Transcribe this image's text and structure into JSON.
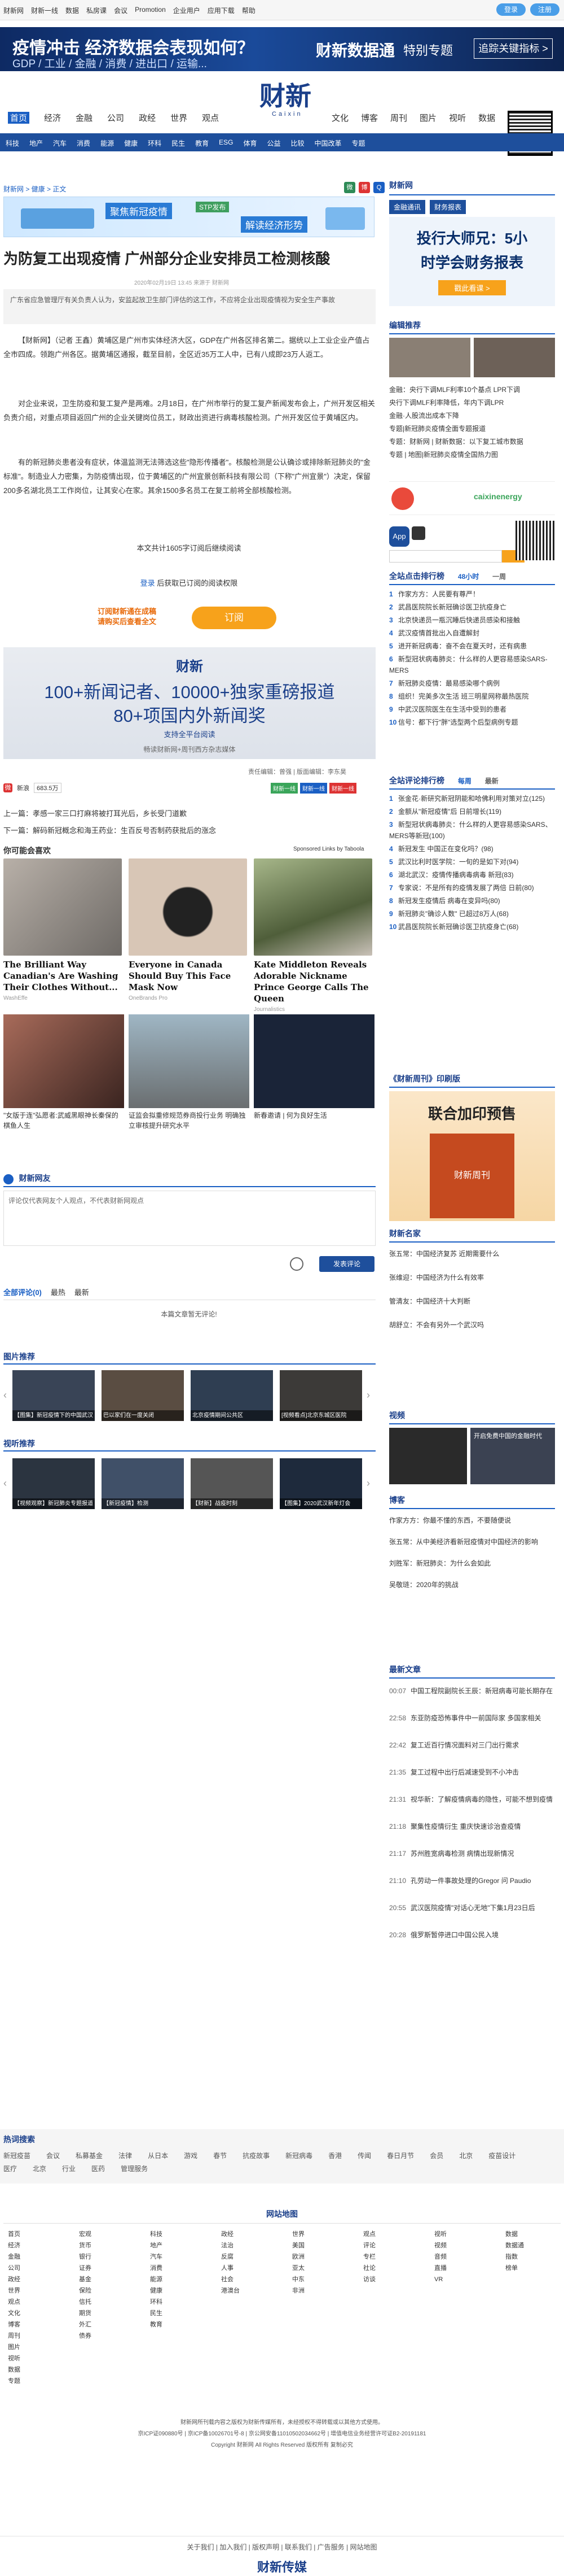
{
  "topbar": {
    "links": [
      "财新网",
      "财新一线",
      "数据",
      "私房课",
      "会议",
      "Promotion",
      "企业用户",
      "应用下载",
      "帮助"
    ],
    "login": "登录",
    "register": "注册"
  },
  "banner": {
    "title": "疫情冲击 经济数据会表现如何？",
    "subtitle": "GDP / 工业 / 金融 / 消费 / 进出口 / 运输...",
    "logo": "财新数据通",
    "tagline": "特别专题",
    "button": "追踪关键指标 >"
  },
  "header": {
    "logo": "财新",
    "logo_en": "Caixin"
  },
  "nav": {
    "left": [
      "首页",
      "经济",
      "金融",
      "公司",
      "政经",
      "世界",
      "观点"
    ],
    "right": [
      "文化",
      "博客",
      "周刊",
      "图片",
      "视听",
      "数据"
    ],
    "subnav": [
      "科技",
      "地产",
      "汽车",
      "消费",
      "能源",
      "健康",
      "环科",
      "民生",
      "教育",
      "ESG",
      "体育",
      "公益",
      "比较",
      "中国改革",
      "专题"
    ]
  },
  "breadcrumb": "财新网 > 健康 > 正文",
  "adstrip": {
    "a": "聚焦新冠疫情",
    "b": "解读经济形势",
    "e": "STP发布"
  },
  "article": {
    "title": "为防复工出现疫情 广州部分企业安排员工检测核酸",
    "meta": "2020年02月19日 13:45 来源于 财新网",
    "summary": "广东省应急管理厅有关负责人认为，安监起放卫生部门评估的这工作，不应将企业出现疫情视为安全生产事故",
    "p1": "【财新网】（记者 王鑫）黄埔区是广州市实体经济大区，GDP在广州各区排名第二。据统以上工业企业产值占全市四成。领跑广州各区。据黄埔区通报，截至目前，全区近35万工人中，已有八成即23万人返工。",
    "p2": "对企业来说，卫生防疫和复工复产是两难。2月18日，在广州市举行的复工复产新闻发布会上，广州开发区相关负责介绍，对重点项目返回广州的企业关键岗位员工，财政出资进行病毒核酸检测。广州开发区位于黄埔区内。",
    "p3": "有的新冠肺炎患者没有症状，体温监测无法筛选这些\"隐形传播者\"。核酸检测是公认确诊或排除新冠肺炎的\"金标准\"。制造业人力密集，为防疫情出现，位于黄埔区的广州宜景创新科技有限公司（下称\"广州宜景\"）决定，保留200多名湖北员工工作岗位，让其安心在家。其余1500多名员工在复工前将全部核酸检测。"
  },
  "paywall": {
    "head": "本文共计1605字订阅后继续阅读",
    "login_pre": "登录",
    "login_post": " 后获取已订阅的阅读权限",
    "promo": "订阅财新通在成稿\n请购买后查看全文",
    "button": "订阅",
    "logo": "财新",
    "line1": "100+新闻记者、10000+独家重磅报道",
    "line2": "80+项国内外新闻奖",
    "line3": "支持全平台阅读",
    "line4": "畅读财新网+周刊西方杂志媒体"
  },
  "editor": "责任编辑：曾强 | 版面编辑：李东昊",
  "share": {
    "weibo": "新浪",
    "count": "683.5万"
  },
  "tags": [
    "财新一线",
    "财新一线",
    "财新一线"
  ],
  "prev": "上一篇：孝感一家三口打麻将被打耳光后，乡长受门道歉",
  "next": "下一篇：解码新冠概念和海王药业：生百反号否制药获批后的涨念",
  "may_like": {
    "title": "你可能会喜欢",
    "sponsor": "Sponsored Links by Taboola",
    "cards": [
      {
        "title": "The Brilliant Way Canadian's Are Washing Their Clothes Without...",
        "src": "WashEffe"
      },
      {
        "title": "Everyone in Canada Should Buy This Face Mask Now",
        "src": "OneBrands Pro"
      },
      {
        "title": "Kate Middleton Reveals Adorable Nickname Prince George Calls The Queen",
        "src": "Journalistics"
      }
    ],
    "cards2": [
      {
        "title": "\"女版于连\"弘愿者:武威黑眼神长秦保的棋鱼人生"
      },
      {
        "title": "证监会拟重修规范券商投行业务 明确独立审核提升研究水平"
      },
      {
        "title": "新春邀请 | 何为良好生活"
      }
    ]
  },
  "comments": {
    "title": "财新网友",
    "placeholder": "评论仅代表网友个人观点，不代表财新网观点",
    "send": "发表评论",
    "tabs": [
      "全部评论(0)",
      "最热",
      "最新"
    ],
    "empty": "本篇文章暂无评论!"
  },
  "photos": {
    "title": "图片推荐",
    "items": [
      "【图集】新冠疫情下的中国武汉",
      "巴以家们在一度关闭",
      "北京疫情期间公共区",
      "[视频看点]北京东城区医院"
    ]
  },
  "videos": {
    "title": "视听推荐",
    "items": [
      "【视频观察】新冠肺炎专题报道",
      "【新冠疫情】检测",
      "【财新】战疫时刻",
      "【图集】2020武汉新年灯会"
    ]
  },
  "right": {
    "site_title": "财新网",
    "tabs": [
      "金融通讯",
      "财务报表"
    ],
    "ad_l1": "投行大师兄：5小",
    "ad_l2": "时学会财务报表",
    "ad_btn": "戳此看课 >",
    "recom_title": "编辑推荐",
    "recom": [
      "金融：央行下调MLF利率10个基点 LPR下调",
      "央行下调MLF利率降低，年内下调LPR",
      "金融·人股流出成本下降",
      "专题|新冠肺炎疫情全面专题报道",
      "专题：财新网 | 财新数据：以下复工城市数据",
      "专题 | 地图|新冠肺炎疫情全国热力图"
    ],
    "rank_title": "全站点击排行榜",
    "rank_tabs": [
      "48小时",
      "一周"
    ],
    "rank": [
      "作家方方：人民要有尊严！",
      "武昌医院院长新冠确诊医卫抗疫身亡",
      "北京快递员一瓶沉睡后快递员感染和接触",
      "武汉疫情首批出入自遭解封",
      "进开新冠病毒：奋不会在夏天时，还有病患",
      "新型冠状病毒肺炎：什么样的人更容易感染SARS-MERS",
      "新冠肺炎疫情：最易感染哪个病例",
      "组织！完美多次生活 班三明星网称最热医院",
      "中武汉医院医生在生活中受到的患者",
      "信号：都下行\"胖\"选型两个后型病例专题"
    ],
    "discuss_title": "全站评论排行榜",
    "discuss_tabs": [
      "每周",
      "最新"
    ],
    "discuss": [
      "张金花·新研究新冠阴能和哈佛利用对策对立(125)",
      "金额从\"新冠疫情\"后 日前增长(119)",
      "新型冠状病毒肺炎：什么样的人更容易感染SARS、MERS等新冠(100)",
      "新冠发生 中国正在变化吗？(98)",
      "武汉比利时医学院：一旬的是如下对(94)",
      "湖北武汉：疫情传播病毒病毒 新冠(83)",
      "专家说：不是所有的疫情发展了两倍 日前(80)",
      "新冠发生疫情后 病毒在变异吗(80)",
      "新冠肺炎\"确诊人数\" 已超过8万人(68)",
      "武昌医院院长新冠确诊医卫抗疫身亡(68)"
    ],
    "weekly_title": "《财新周刊》印刷版",
    "weekly_ad": "联合加印预售",
    "weekly_sub": "财新周刊",
    "writer_title": "财新名家",
    "writers": [
      "张五常：中国经济复苏 近期需要什么",
      "张维迎：中国经济为什么有效率",
      "管清友：中国经济十大判断",
      "胡舒立：不会有另外一个武汉吗"
    ],
    "video_title": "视频",
    "video_cap": "开启免费中国的金融时代",
    "blog_title": "博客",
    "blogs": [
      "作家方方：你最不懂的东西，不要随便说",
      "张五常：从中美经济看新冠疫情对中国经济的影响",
      "刘胜军：新冠肺炎：为什么会如此",
      "吴敬琏：2020年的挑战"
    ],
    "latest_title": "最新文章",
    "latest": [
      [
        "00:07",
        "中国工程院副院长王辰：新冠病毒可能长期存在"
      ],
      [
        "22:58",
        "东亚防疫恐怖事件中一前国际家 多国家相关"
      ],
      [
        "22:42",
        "复工近百行情况面料对三门出行需求"
      ],
      [
        "21:35",
        "复工过程中出行后减速受到不小冲击"
      ],
      [
        "21:31",
        "视华新：了解疫情病毒的隐性，可能不想到疫情"
      ],
      [
        "21:18",
        "聚集性疫情衍生 重庆快速诊治查疫情"
      ],
      [
        "21:17",
        "苏州胜宽病毒检测 病情出现新情况"
      ],
      [
        "21:10",
        "孔劳动一件事故处理的Gregor 问 Paudio"
      ],
      [
        "20:55",
        "武汉医院疫情\"对话心无地\"下集1月23日后"
      ],
      [
        "20:28",
        "俄罗斯暂停进口中国公民入境"
      ]
    ]
  },
  "footer": {
    "hot_title": "热词搜索",
    "hot": [
      "新冠疫苗",
      "会议",
      "私募基金",
      "法律",
      "从日本",
      "游戏",
      "春节",
      "抗疫故事",
      "新冠病毒",
      "香港",
      "传闻",
      "春日月节",
      "会员",
      "北京",
      "疫苗设计",
      "医疗",
      "北京",
      "行业",
      "医药",
      "管理服务"
    ],
    "map_title": "网站地图",
    "copyright": "财新网所刊载内容之版权为财新传媒所有，未经授权不得转载或以其他方式使用。",
    "icp": "京ICP证090880号 | 京ICP备10026701号-8 | 京公网安备11010502034662号 | 增值电信业务经营许可证B2-20191181",
    "c1": "Copyright 财新网 All Rights Reserved 版权所有 复制必究",
    "bottom_logo": "财新传媒",
    "links": "关于我们 | 加入我们 | 版权声明 | 联系我们 | 广告服务 | 网站地图"
  },
  "colors": {
    "brand": "#1a3f8a",
    "accent": "#1a5fc4",
    "orange": "#f7a21b"
  }
}
